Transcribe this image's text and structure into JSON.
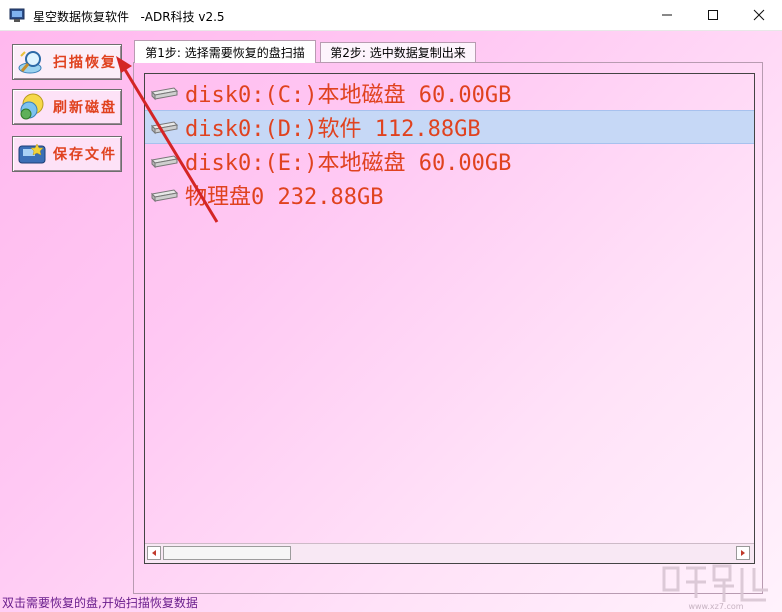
{
  "window": {
    "title": "星空数据恢复软件   -ADR科技 v2.5",
    "controls": [
      "minimize",
      "maximize",
      "close"
    ]
  },
  "sidebar": {
    "buttons": [
      {
        "label": "扫描恢复",
        "icon": "magnifier-disk-icon"
      },
      {
        "label": "刷新磁盘",
        "icon": "refresh-balls-icon"
      },
      {
        "label": "保存文件",
        "icon": "save-disk-icon"
      }
    ]
  },
  "tabs": [
    {
      "label": "第1步: 选择需要恢复的盘扫描",
      "active": true
    },
    {
      "label": "第2步: 选中数据复制出来",
      "active": false
    }
  ],
  "disks": [
    {
      "label": "disk0:(C:)本地磁盘 60.00GB",
      "selected": false
    },
    {
      "label": "disk0:(D:)软件 112.88GB",
      "selected": true
    },
    {
      "label": "disk0:(E:)本地磁盘 60.00GB",
      "selected": false
    },
    {
      "label": "物理盘0 232.88GB",
      "selected": false
    }
  ],
  "status": {
    "text": "双击需要恢复的盘,开始扫描恢复数据"
  },
  "colors": {
    "accent_text": "#e0421f",
    "status_text": "#6a1d8c",
    "selection": "#c6d8f6",
    "annotation_arrow": "#d42525"
  }
}
